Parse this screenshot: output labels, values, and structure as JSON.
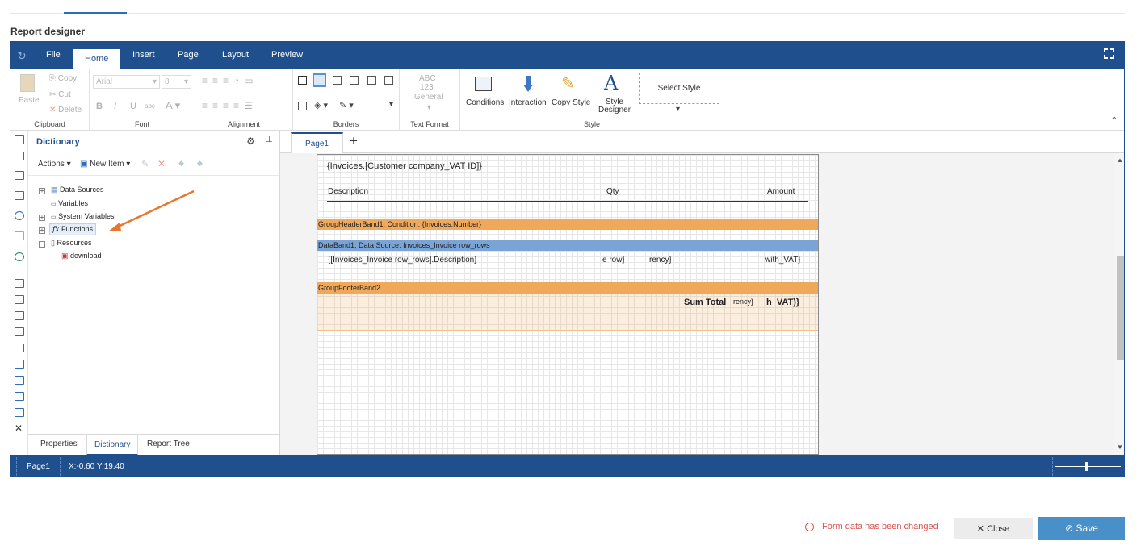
{
  "page_title": "Report designer",
  "menu": {
    "tabs": [
      "File",
      "Home",
      "Insert",
      "Page",
      "Layout",
      "Preview"
    ],
    "active": "Home"
  },
  "ribbon": {
    "clipboard": {
      "label": "Clipboard",
      "paste": "Paste",
      "copy": "Copy",
      "cut": "Cut",
      "delete": "Delete"
    },
    "font": {
      "label": "Font",
      "font_name": "Arial",
      "font_size": "8"
    },
    "alignment": {
      "label": "Alignment"
    },
    "borders": {
      "label": "Borders"
    },
    "text_format": {
      "label": "Text Format",
      "sample_line1": "ABC",
      "sample_line2": "123",
      "format": "General"
    },
    "style": {
      "label": "Style",
      "conditions": "Conditions",
      "interaction": "Interaction",
      "copy_style": "Copy Style",
      "style_designer_line1": "Style",
      "style_designer_line2": "Designer",
      "select_style": "Select Style"
    }
  },
  "dictionary": {
    "title": "Dictionary",
    "actions": "Actions",
    "new_item": "New Item",
    "tree": [
      {
        "label": "Data Sources"
      },
      {
        "label": "Variables"
      },
      {
        "label": "System Variables"
      },
      {
        "label": "Functions"
      },
      {
        "label": "Resources"
      },
      {
        "label": "download"
      }
    ],
    "bottom_tabs": [
      "Properties",
      "Dictionary",
      "Report Tree"
    ],
    "active_tab": "Dictionary"
  },
  "designer": {
    "page_tab": "Page1",
    "fields": {
      "vat_id": "{Invoices.[Customer company_VAT ID]}",
      "col_description": "Description",
      "col_qty": "Qty",
      "col_amount": "Amount",
      "row_description": "{[Invoices_Invoice row_rows].Description}",
      "row_qty": "e row}",
      "row_currency": "rency}",
      "row_vat": "with_VAT}",
      "sum_total": "Sum Total",
      "sum_currency": "rency}",
      "sum_vat": "h_VAT)}"
    },
    "bands": {
      "group_header": "GroupHeaderBand1; Condition: {Invoices.Number}",
      "data_band": "DataBand1; Data Source: Invoices_Invoice row_rows",
      "group_footer": "GroupFooterBand2"
    }
  },
  "statusbar": {
    "page": "Page1",
    "coords": "X:-0.60 Y:19.40"
  },
  "footer": {
    "notice": "Form data has been changed",
    "close": "Close",
    "save": "Save"
  },
  "colors": {
    "brand": "#1f4f8d",
    "group_band": "#f0a85a",
    "data_band": "#7aa4d6",
    "save": "#4a90c8",
    "notice": "#d9534f"
  }
}
